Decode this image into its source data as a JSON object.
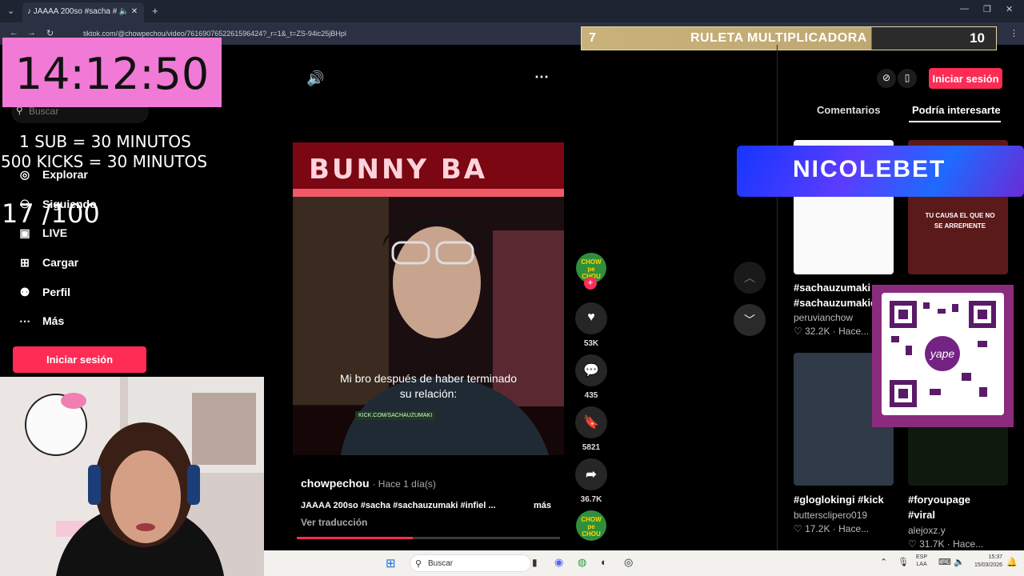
{
  "browser": {
    "tab_title": "JAAAA 200so #sacha #sach",
    "url": "tiktok.com/@chowpechou/video/7616907652261596424?_r=1&_t=ZS-94ic25jBHpl"
  },
  "overlay": {
    "timer": "14:12:50",
    "rule_sub": "1 SUB      = 30 MINUTOS",
    "rule_kicks": "500 KICKS = 30 MINUTOS",
    "counter": "17 /100",
    "roulette_left": "7",
    "roulette_title": "RULETA MULTIPLICADORA",
    "roulette_right": "10",
    "nicolebet": "NICOLEBET"
  },
  "sidebar": {
    "search_placeholder": "Buscar",
    "items": [
      {
        "label": "Explorar"
      },
      {
        "label": "Siguiendo"
      },
      {
        "label": "LIVE"
      },
      {
        "label": "Cargar"
      },
      {
        "label": "Perfil"
      },
      {
        "label": "Más"
      }
    ],
    "login": "Iniciar sesión"
  },
  "video": {
    "caption_line1": "Mi bro después de haber terminado",
    "caption_line2": "su relación:",
    "kick_tag": "KICK.COM/SACHAUZUMAKI",
    "sign_text": "BUNNY BA",
    "author": "chowpechou",
    "time": "· Hace 1 día(s)",
    "description": "JAAAA 200so #sacha #sachauzumaki #infiel ...",
    "more": "más",
    "translate": "Ver traducción",
    "progress": 0.44,
    "likes": "53K",
    "comments": "435",
    "saves": "5821",
    "shares": "36.7K"
  },
  "right": {
    "login": "Iniciar sesión",
    "tab_comments": "Comentarios",
    "tab_suggest": "Podría interesarte",
    "cards": [
      {
        "tag": "#sachauzumaki",
        "tag2": "#sachauzumakic",
        "user": "peruvianchow",
        "meta": "♡ 32.2K · Hace..."
      },
      {
        "tag": "#gloglokingi #kick",
        "user": "buttersclipero019",
        "meta": "♡ 17.2K · Hace..."
      },
      {
        "tag": "#foryoupage",
        "tag2": "#viral",
        "user": "alejoxz.y",
        "meta": "♡ 31.7K · Hace..."
      }
    ],
    "thumb_text": "TU CAUSA EL QUE NO SE ARREPIENTE"
  },
  "taskbar": {
    "search": "Buscar",
    "lang": "ESP",
    "lang2": "LAA",
    "time": "15:37",
    "date": "15/03/2026"
  }
}
